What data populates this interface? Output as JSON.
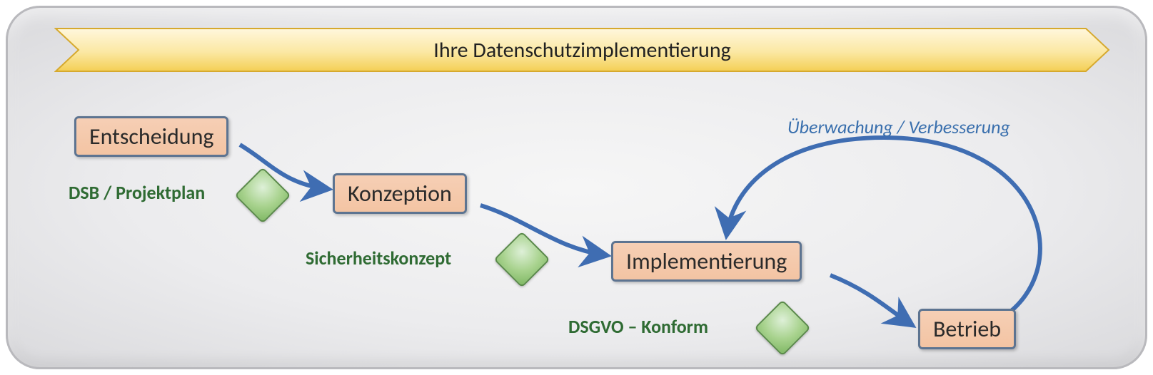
{
  "banner": {
    "title": "Ihre Datenschutzimplementierung"
  },
  "steps": {
    "s1": "Entscheidung",
    "s2": "Konzeption",
    "s3": "Implementierung",
    "s4": "Betrieb"
  },
  "milestones": {
    "m1": "DSB / Projektplan",
    "m2": "Sicherheitskonzept",
    "m3": "DSGVO – Konform"
  },
  "feedback": {
    "label": "Überwachung / Verbesserung"
  }
}
